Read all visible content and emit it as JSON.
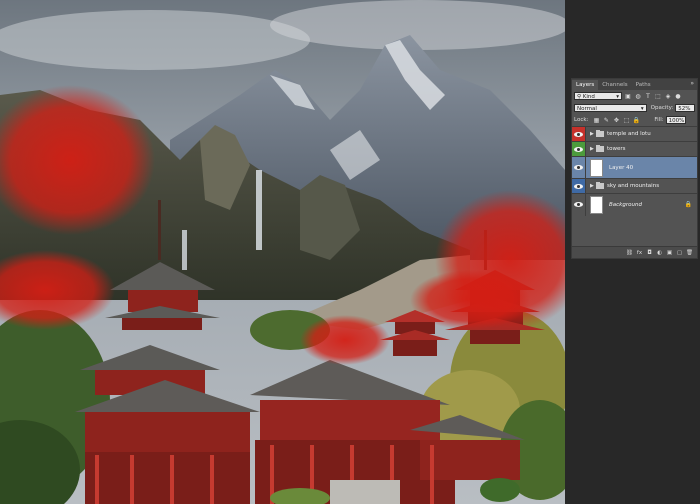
{
  "canvas": {
    "description_icon": "temple-landscape-artwork",
    "accent_red": "#d42a20"
  },
  "panel": {
    "tabs": [
      {
        "label": "Layers"
      },
      {
        "label": "Channels"
      },
      {
        "label": "Paths"
      }
    ],
    "tab_menu_icon": "double-chevron-icon",
    "filter": {
      "kind": "Kind"
    },
    "blend_mode": "Normal",
    "opacity": {
      "label": "Opacity:",
      "value": "52%"
    },
    "lock": {
      "label": "Lock:"
    },
    "fill": {
      "label": "Fill:",
      "value": "100%"
    },
    "layers": [
      {
        "name": "temple and lotu",
        "type": "group",
        "tag_color": "#c6312b"
      },
      {
        "name": "towers",
        "type": "group",
        "tag_color": "#4c9b3c"
      },
      {
        "name": "Layer 40",
        "type": "layer",
        "tag_color": "none",
        "selected": true
      },
      {
        "name": "sky and mountains",
        "type": "group",
        "tag_color": "#3f6aa5"
      },
      {
        "name": "Background",
        "type": "layer",
        "tag_color": "none",
        "locked": true
      }
    ],
    "footer_icons": [
      "link-icon",
      "fx-icon",
      "mask-icon",
      "adjustment-icon",
      "new-group-icon",
      "new-layer-icon",
      "trash-icon"
    ],
    "footer_glyphs": {
      "link": "⛓",
      "fx": "fx",
      "mask": "◘",
      "adj": "◐",
      "group": "▣",
      "new": "▢",
      "trash": "🗑"
    },
    "filter_glyphs": {
      "a": "▣",
      "b": "◍",
      "c": "T",
      "d": "⬚",
      "e": "◈",
      "f": "●"
    },
    "lock_glyphs": {
      "a": "▦",
      "b": "✎",
      "c": "✥",
      "d": "⬚",
      "e": "🔒"
    }
  }
}
